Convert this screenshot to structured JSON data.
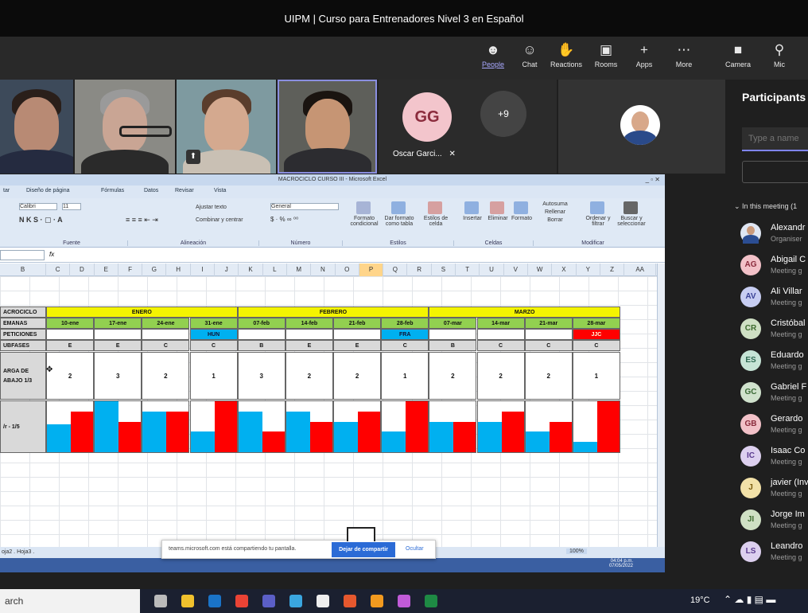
{
  "window": {
    "title": "UIPM | Curso para Entrenadores Nivel 3 en Español"
  },
  "toolbar": [
    {
      "id": "people",
      "label": "People",
      "icon": "☻",
      "active": true
    },
    {
      "id": "chat",
      "label": "Chat",
      "icon": "☺"
    },
    {
      "id": "reactions",
      "label": "Reactions",
      "icon": "✋"
    },
    {
      "id": "rooms",
      "label": "Rooms",
      "icon": "▣"
    },
    {
      "id": "apps",
      "label": "Apps",
      "icon": "+"
    },
    {
      "id": "more",
      "label": "More",
      "icon": "⋯"
    },
    {
      "id": "camera",
      "label": "Camera",
      "icon": "■"
    },
    {
      "id": "mic",
      "label": "Mic",
      "icon": "⚲"
    }
  ],
  "video": {
    "avatar_initials": "GG",
    "avatar_name": "Oscar Garci...",
    "overflow_count": "+9"
  },
  "participants": {
    "title": "Participants",
    "search_placeholder": "Type a name",
    "section": "In this meeting (1",
    "items": [
      {
        "initials": "",
        "name": "Alexandr",
        "role": "Organiser",
        "color": "#4a6fb5",
        "photo": true
      },
      {
        "initials": "AG",
        "name": "Abigail C",
        "role": "Meeting g",
        "color": "#f2c1c8",
        "fg": "#8a2b3c"
      },
      {
        "initials": "AV",
        "name": "Ali Villar",
        "role": "Meeting g",
        "color": "#c7cdf2",
        "fg": "#3a4296"
      },
      {
        "initials": "CR",
        "name": "Cristóbal",
        "role": "Meeting g",
        "color": "#cfe0c4",
        "fg": "#3d6b2e"
      },
      {
        "initials": "ES",
        "name": "Eduardo",
        "role": "Meeting g",
        "color": "#c6e4d6",
        "fg": "#2f6a53"
      },
      {
        "initials": "GC",
        "name": "Gabriel F",
        "role": "Meeting g",
        "color": "#d0e2cd",
        "fg": "#3b6a36"
      },
      {
        "initials": "GB",
        "name": "Gerardo",
        "role": "Meeting g",
        "color": "#f2c1c8",
        "fg": "#8a2b3c"
      },
      {
        "initials": "IC",
        "name": "Isaac Co",
        "role": "Meeting g",
        "color": "#ddd0ef",
        "fg": "#5a3a8e"
      },
      {
        "initials": "J",
        "name": "javier (Inv",
        "role": "Meeting g",
        "color": "#f2e1a8",
        "fg": "#7a5c0e"
      },
      {
        "initials": "JI",
        "name": "Jorge Im",
        "role": "Meeting g",
        "color": "#cfe0c4",
        "fg": "#3d6b2e"
      },
      {
        "initials": "LS",
        "name": "Leandro",
        "role": "Meeting g",
        "color": "#ddd0ef",
        "fg": "#5a3a8e"
      }
    ]
  },
  "excel": {
    "title": "MACROCICLO CURSO III - Microsoft Excel",
    "menu": [
      "tar",
      "Diseño de página",
      "Fórmulas",
      "Datos",
      "Revisar",
      "Vista"
    ],
    "font_name": "Calibri",
    "font_size": "11",
    "wrap_label": "Ajustar texto",
    "merge_label": "Combinar y centrar",
    "number_format": "General",
    "groups": [
      "Fuente",
      "Alineación",
      "Número",
      "Estilos",
      "Celdas",
      "Modificar"
    ],
    "ribbon_buttons": [
      "Formato condicional",
      "Dar formato como tabla",
      "Estilos de celda",
      "Insertar",
      "Eliminar",
      "Formato",
      "Autosuma",
      "Rellenar",
      "Borrar",
      "Ordenar y filtrar",
      "Buscar y seleccionar"
    ],
    "cell_ref": "",
    "columns": [
      "B",
      "C",
      "D",
      "E",
      "F",
      "G",
      "H",
      "I",
      "J",
      "K",
      "L",
      "M",
      "N",
      "O",
      "P",
      "Q",
      "R",
      "S",
      "T",
      "U",
      "V",
      "W",
      "X",
      "Y",
      "Z",
      "AA"
    ],
    "row_labels": [
      "ACROCICLO",
      "EMANAS",
      "PETICIONES",
      "UBFASES",
      "ARGA DE\nABAJO 1/3",
      "/r - 1/5"
    ],
    "months": [
      "ENERO",
      "FEBRERO",
      "MARZO"
    ],
    "weeks": [
      "10-ene",
      "17-ene",
      "24-ene",
      "31-ene",
      "07-feb",
      "14-feb",
      "21-feb",
      "28-feb",
      "07-mar",
      "14-mar",
      "21-mar",
      "28-mar"
    ],
    "competitions": [
      "",
      "",
      "",
      "HUN",
      "",
      "",
      "",
      "FRA",
      "",
      "",
      "",
      "JJC"
    ],
    "subfases": [
      "E",
      "E",
      "C",
      "C",
      "B",
      "E",
      "E",
      "C",
      "B",
      "C",
      "C",
      "C"
    ],
    "carga": [
      "2",
      "3",
      "2",
      "1",
      "3",
      "2",
      "2",
      "1",
      "2",
      "2",
      "2",
      "1"
    ],
    "bars_blue": [
      0.55,
      1.0,
      0.8,
      0.4,
      0.8,
      0.8,
      0.6,
      0.4,
      0.6,
      0.6,
      0.4,
      0.2
    ],
    "bars_red": [
      0.8,
      0.6,
      0.8,
      1.0,
      0.4,
      0.6,
      0.8,
      1.0,
      0.6,
      0.8,
      0.6,
      1.0
    ],
    "sheet_tabs": "oja2 . Hoja3 . ",
    "zoom": "100%",
    "share_text": "teams.microsoft.com está compartiendo tu pantalla.",
    "share_stop": "Dejar de compartir",
    "share_hide": "Ocultar",
    "clock_time": "04:04 p.m.",
    "clock_date": "07/05/2022"
  },
  "taskbar": {
    "search": "arch",
    "weather": "19°C"
  },
  "colors": {
    "yellow": "#f4f400",
    "green": "#92d050",
    "blue": "#00b0f0",
    "red": "#ff0000",
    "gray": "#d9d9d9"
  }
}
